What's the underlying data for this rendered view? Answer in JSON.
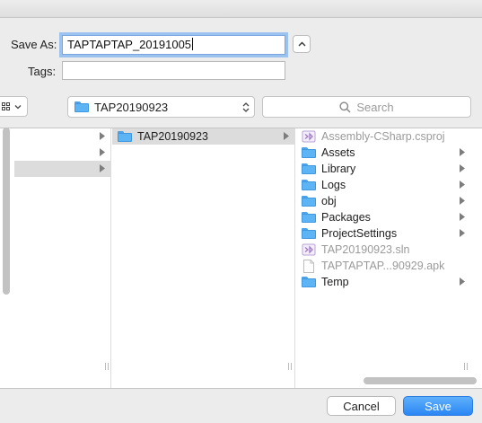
{
  "dialog": {
    "save_as_label": "Save As:",
    "save_as_value": "TAPTAPTAP_20191005",
    "tags_label": "Tags:",
    "tags_value": "",
    "location": "TAP20190923",
    "search_placeholder": "Search",
    "cancel_label": "Cancel",
    "save_label": "Save"
  },
  "columns": {
    "col1": [
      {
        "name": "",
        "has_children": true,
        "selected": false
      },
      {
        "name": "",
        "has_children": true,
        "selected": false
      },
      {
        "name": "",
        "has_children": true,
        "selected": true
      }
    ],
    "col2": [
      {
        "name": "TAP20190923",
        "icon": "folder-icon",
        "has_children": true,
        "selected": true
      }
    ],
    "col3": [
      {
        "name": "Assembly-CSharp.csproj",
        "icon": "visual-studio-icon",
        "dim": true,
        "has_children": false
      },
      {
        "name": "Assets",
        "icon": "folder-icon",
        "dim": false,
        "has_children": true
      },
      {
        "name": "Library",
        "icon": "folder-icon",
        "dim": false,
        "has_children": true
      },
      {
        "name": "Logs",
        "icon": "folder-icon",
        "dim": false,
        "has_children": true
      },
      {
        "name": "obj",
        "icon": "folder-icon",
        "dim": false,
        "has_children": true
      },
      {
        "name": "Packages",
        "icon": "folder-icon",
        "dim": false,
        "has_children": true
      },
      {
        "name": "ProjectSettings",
        "icon": "folder-icon",
        "dim": false,
        "has_children": true
      },
      {
        "name": "TAP20190923.sln",
        "icon": "visual-studio-icon",
        "dim": true,
        "has_children": false
      },
      {
        "name": "TAPTAPTAP...90929.apk",
        "icon": "document-icon",
        "dim": true,
        "has_children": false
      },
      {
        "name": "Temp",
        "icon": "folder-icon",
        "dim": false,
        "has_children": true
      }
    ]
  },
  "colors": {
    "accent": "#2a86f4",
    "folder": "#5db4f4",
    "focus_ring": "#9cc3ef",
    "vs_purple": "#a07cc5"
  }
}
